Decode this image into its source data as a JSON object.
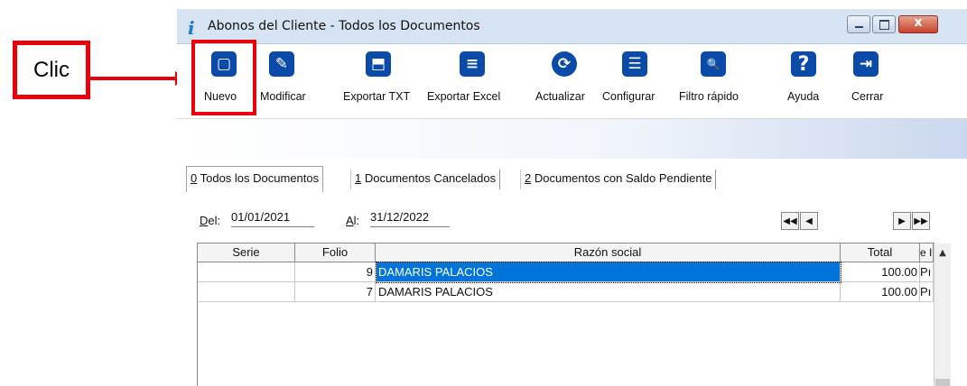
{
  "annotation": {
    "label": "Clic"
  },
  "window": {
    "title": "Abonos del Cliente - Todos los Documentos",
    "title_icon": "i",
    "close_glyph": "x"
  },
  "toolbar": {
    "buttons": [
      {
        "label": "Nuevo",
        "icon": "new-document-icon",
        "glyph": "▢"
      },
      {
        "label": "Modificar",
        "icon": "edit-document-icon",
        "glyph": "✎"
      },
      {
        "label": "Exportar TXT",
        "icon": "export-txt-icon",
        "glyph": "⬒"
      },
      {
        "label": "Exportar Excel",
        "icon": "export-excel-icon",
        "glyph": "≡"
      },
      {
        "label": "Actualizar",
        "icon": "refresh-icon",
        "glyph": "⟳"
      },
      {
        "label": "Configurar",
        "icon": "configure-icon",
        "glyph": "☰"
      },
      {
        "label": "Filtro rápido",
        "icon": "quick-filter-icon",
        "glyph": "🔍"
      },
      {
        "label": "Ayuda",
        "icon": "help-icon",
        "glyph": "?"
      },
      {
        "label": "Cerrar",
        "icon": "close-exit-icon",
        "glyph": "⇥"
      }
    ]
  },
  "tabs": [
    {
      "key": "0",
      "label": " Todos los Documentos"
    },
    {
      "key": "1",
      "label": " Documentos Cancelados"
    },
    {
      "key": "2",
      "label": " Documentos con Saldo Pendiente"
    }
  ],
  "filters": {
    "del_label_key": "D",
    "del_label_rest": "el:",
    "del_value": "01/01/2021",
    "al_label_key": "A",
    "al_label_rest": "l:",
    "al_value": "31/12/2022"
  },
  "nav": {
    "first": "◀◀",
    "prev": "◀",
    "next": "▶",
    "last": "▶▶"
  },
  "table": {
    "columns": [
      "Serie",
      "Folio",
      "Razón social",
      "Total",
      "e I"
    ],
    "rows": [
      {
        "serie": "",
        "folio": "9",
        "razon_social": "DAMARIS PALACIOS",
        "total": "100.00",
        "extra": "Pı",
        "selected": true
      },
      {
        "serie": "",
        "folio": "7",
        "razon_social": "DAMARIS PALACIOS",
        "total": "100.00",
        "extra": "Pı",
        "selected": false
      }
    ],
    "scroll_up": "▲"
  }
}
